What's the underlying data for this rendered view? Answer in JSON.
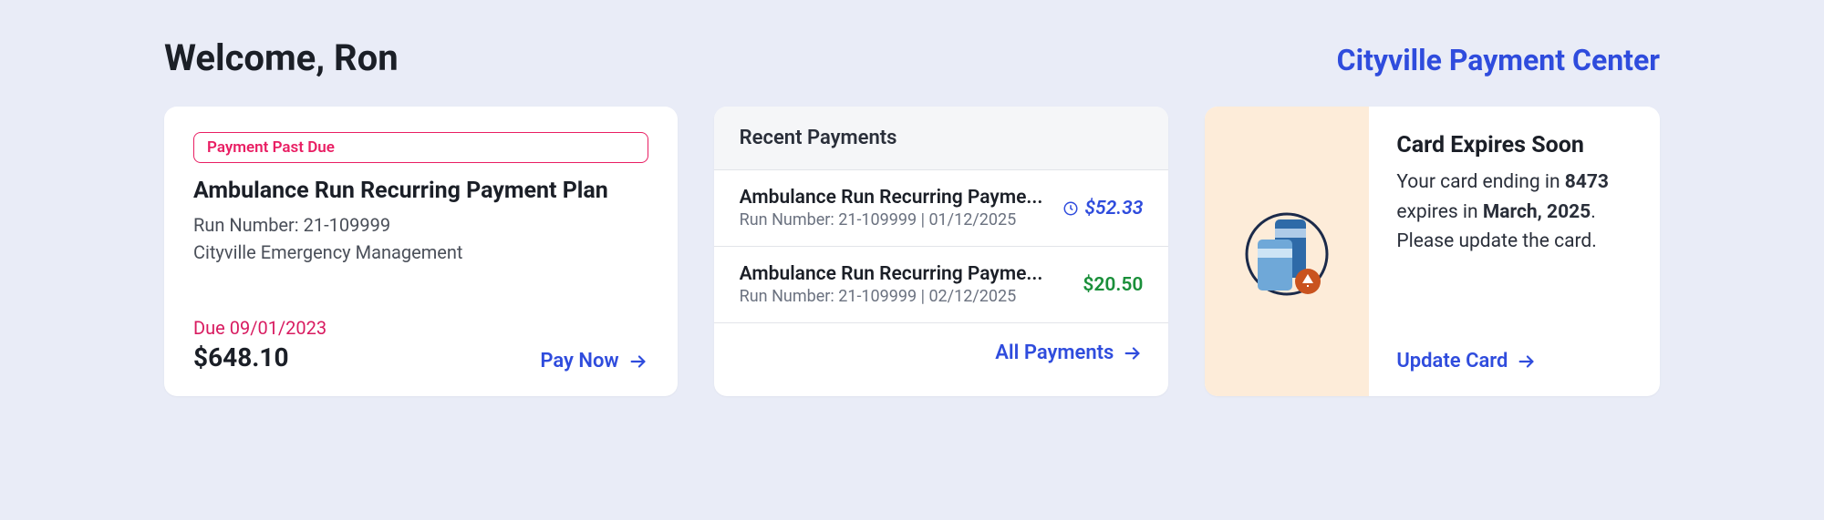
{
  "header": {
    "welcome": "Welcome, Ron",
    "center_name": "Cityville Payment Center"
  },
  "plan": {
    "badge": "Payment Past Due",
    "title": "Ambulance Run Recurring Payment Plan",
    "run_number_label": "Run Number: 21-109999",
    "org": "Cityville Emergency Management",
    "due_label": "Due 09/01/2023",
    "amount": "$648.10",
    "pay_now_label": "Pay Now"
  },
  "recent": {
    "header": "Recent Payments",
    "all_payments_label": "All Payments",
    "items": [
      {
        "title": "Ambulance Run Recurring Payme...",
        "sub": "Run Number: 21-109999 | 01/12/2025",
        "amount": "$52.33",
        "status": "pending"
      },
      {
        "title": "Ambulance Run Recurring Payme...",
        "sub": "Run Number: 21-109999 | 02/12/2025",
        "amount": "$20.50",
        "status": "paid"
      }
    ]
  },
  "expire": {
    "title": "Card Expires Soon",
    "text_prefix": "Your card ending in ",
    "last4": "8473",
    "text_mid": " expires in ",
    "month": "March, 2025",
    "text_suffix": ". Please update the card.",
    "update_label": "Update Card"
  }
}
